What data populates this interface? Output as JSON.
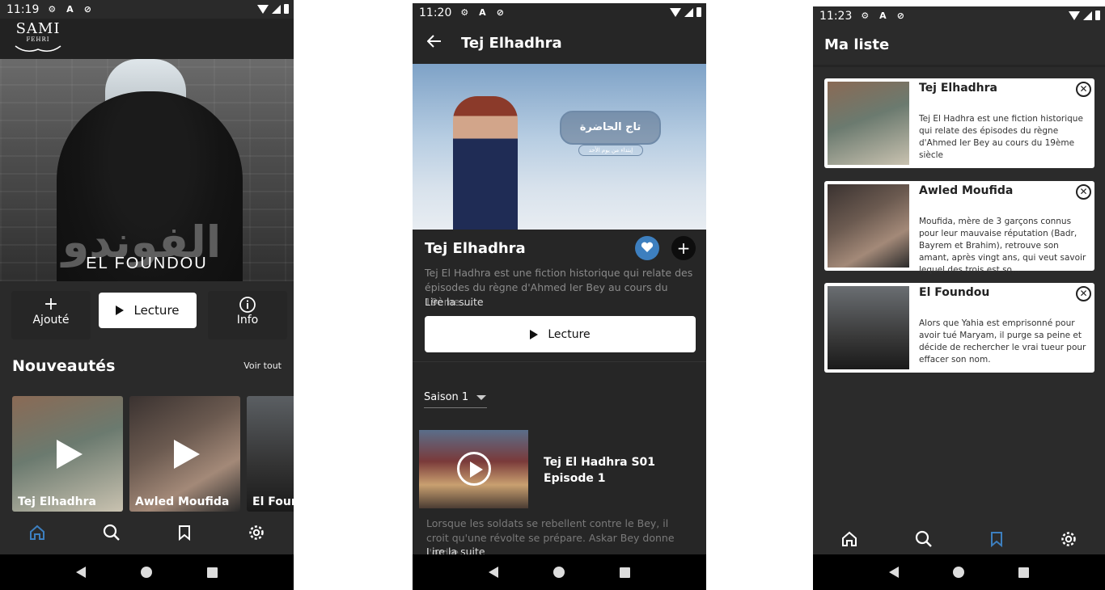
{
  "phone1": {
    "status_time": "11:19",
    "logo_text": "SAMI",
    "logo_sub": "FEHRI",
    "hero_title": "EL FOUNDOU",
    "hero_arabic": "الفوندو",
    "actions": {
      "added_label": "Ajouté",
      "play_label": "Lecture",
      "info_label": "Info"
    },
    "section_title": "Nouveautés",
    "see_all": "Voir tout",
    "cards": [
      {
        "label": "Tej Elhadhra"
      },
      {
        "label": "Awled Moufida"
      },
      {
        "label": "El Foundou"
      }
    ]
  },
  "phone2": {
    "status_time": "11:20",
    "title": "Tej Elhadhra",
    "hero_arabic": "تاج الحاضرة",
    "hero_sub": "إبتداء من يوم الأحد",
    "show_name": "Tej Elhadhra",
    "description": "Tej El Hadhra est une fiction historique qui relate des épisodes du règne d'Ahmed Ier Bey au cours du 19ème ...",
    "read_more": "Lire la suite",
    "play_label": "Lecture",
    "season": "Saison 1",
    "episode_title": "Tej El Hadhra S01 Episode 1",
    "episode_desc": "Lorsque les soldats se rebellent contre le Bey, il croit qu'une révolte se prépare. Askar Bey donne l'ordre ...",
    "episode_more": "Lire la suite"
  },
  "phone3": {
    "status_time": "11:23",
    "title": "Ma liste",
    "items": [
      {
        "name": "Tej Elhadhra",
        "desc": "Tej El Hadhra est une fiction historique qui relate des épisodes du règne d'Ahmed Ier Bey au cours du 19ème siècle"
      },
      {
        "name": "Awled Moufida",
        "desc": "Moufida, mère de 3 garçons connus pour leur mauvaise réputation (Badr, Bayrem et Brahim), retrouve son amant, après vingt ans, qui veut savoir lequel des trois est so..."
      },
      {
        "name": "El Foundou",
        "desc": "Alors que Yahia est emprisonné pour avoir tué Maryam, il purge sa peine et décide de rechercher le vrai tueur pour effacer son nom."
      }
    ]
  },
  "colors": {
    "accent": "#3d7fbf",
    "background": "#2a2a2a"
  },
  "icons": [
    "settings-icon",
    "a-icon",
    "sync-icon",
    "wifi-icon",
    "signal-icon",
    "battery-icon",
    "plus-icon",
    "play-icon",
    "info-icon",
    "home-icon",
    "search-icon",
    "bookmark-icon",
    "gear-icon",
    "back-arrow-icon",
    "heart-icon",
    "close-icon"
  ]
}
